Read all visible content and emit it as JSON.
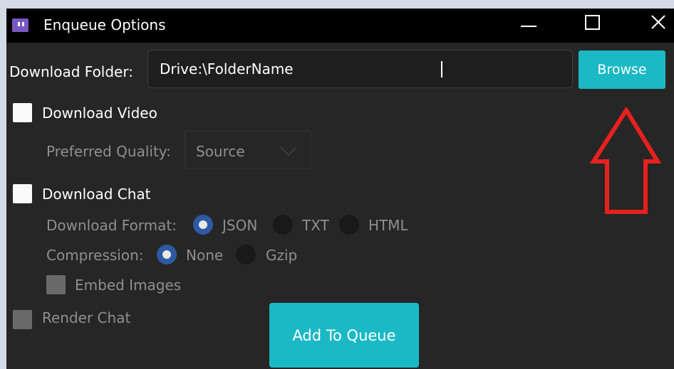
{
  "window": {
    "title": "Enqueue Options"
  },
  "download_folder": {
    "label": "Download Folder:",
    "value": "Drive:\\FolderName",
    "browse_label": "Browse"
  },
  "video": {
    "label": "Download Video",
    "checked": false,
    "quality_label": "Preferred Quality:",
    "quality_value": "Source"
  },
  "chat": {
    "label": "Download Chat",
    "checked": false,
    "format_label": "Download Format:",
    "format_options": [
      "JSON",
      "TXT",
      "HTML"
    ],
    "format_selected": "JSON",
    "compression_label": "Compression:",
    "compression_options": [
      "None",
      "Gzip"
    ],
    "compression_selected": "None",
    "embed_label": "Embed Images"
  },
  "render_chat": {
    "label": "Render Chat"
  },
  "add_button": {
    "label": "Add To Queue"
  },
  "colors": {
    "accent": "#1bb9c6",
    "radio_checked": "#2e5aa3",
    "annotation": "#e8201e"
  }
}
